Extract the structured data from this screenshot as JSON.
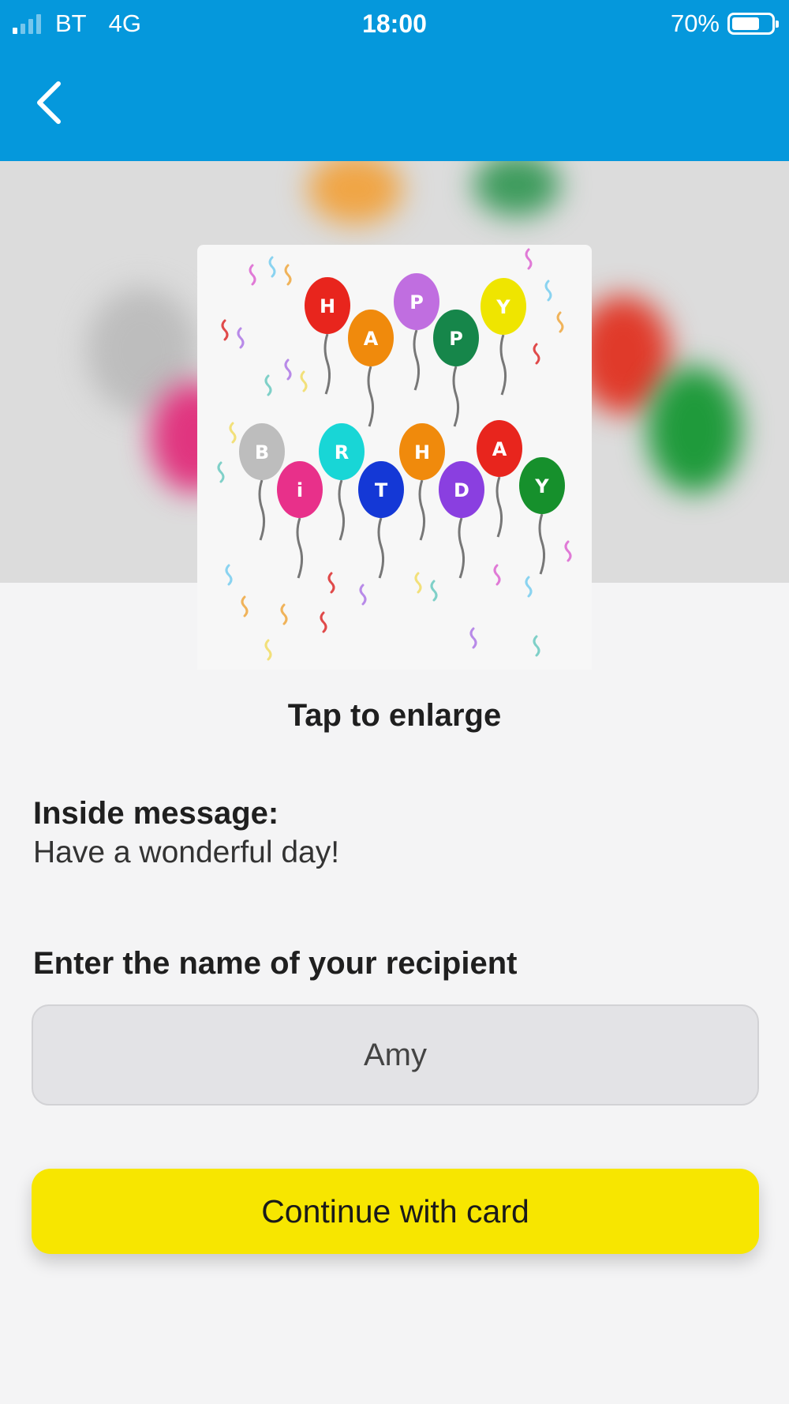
{
  "status_bar": {
    "carrier": "BT",
    "network": "4G",
    "time": "18:00",
    "battery_text": "70%",
    "battery_level": 0.7
  },
  "nav": {
    "back_icon": "chevron-left-icon"
  },
  "card": {
    "balloon_letters": [
      "H",
      "A",
      "P",
      "P",
      "Y",
      "B",
      "i",
      "R",
      "T",
      "H",
      "D",
      "A",
      "Y"
    ],
    "tap_hint": "Tap to enlarge"
  },
  "inside": {
    "heading": "Inside message:",
    "message": "Have a wonderful day!"
  },
  "recipient": {
    "heading": "Enter the name of your recipient",
    "value": "Amy"
  },
  "actions": {
    "continue_label": "Continue with card"
  },
  "colors": {
    "header_blue": "#0598dc",
    "button_yellow": "#f7e600",
    "background": "#f4f4f5"
  }
}
